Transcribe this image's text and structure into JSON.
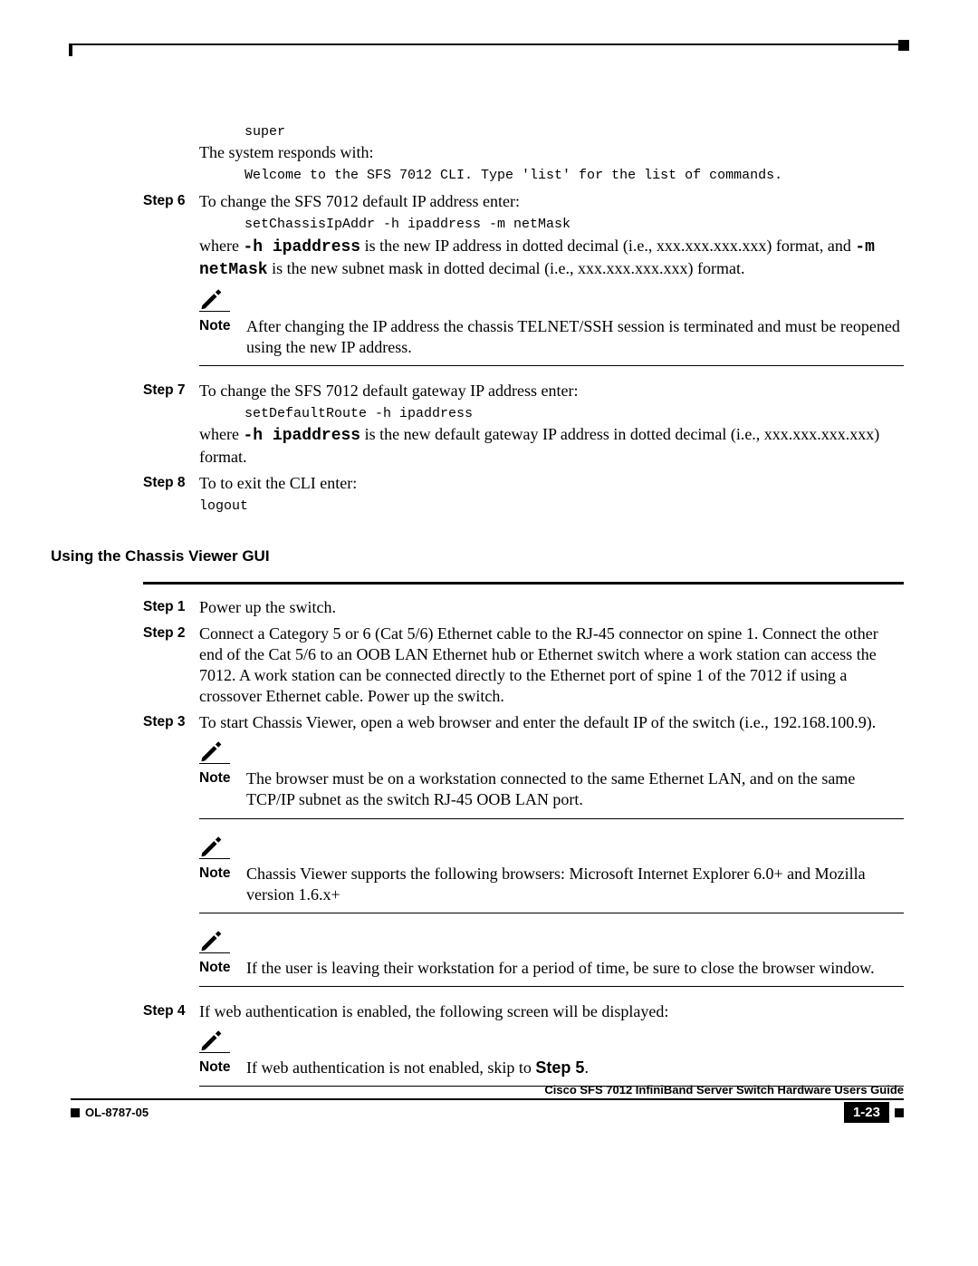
{
  "intro": {
    "code_super": "super",
    "system_responds": "The system responds with:",
    "code_welcome": "Welcome to the SFS 7012 CLI. Type 'list' for the list of commands."
  },
  "section1": {
    "step6": {
      "label": "Step 6",
      "text": "To change the SFS 7012 default IP address enter:",
      "code": "setChassisIpAddr -h ipaddress -m netMask",
      "where_pre": "where ",
      "h_ip": "-h ipaddress",
      "where_mid": " is the new IP address in dotted decimal (i.e., xxx.xxx.xxx.xxx) format, and ",
      "m_net": "-m netMask",
      "where_post": " is the new subnet mask in dotted decimal (i.e., xxx.xxx.xxx.xxx) format.",
      "note_label": "Note",
      "note_text": "After changing the IP address the chassis TELNET/SSH session is terminated and must be reopened using the new IP address."
    },
    "step7": {
      "label": "Step 7",
      "text": "To change the SFS 7012 default gateway IP address enter:",
      "code": "setDefaultRoute -h ipaddress",
      "where_pre": "where ",
      "h_ip": "-h ipaddress",
      "where_post": " is the new default gateway IP address in dotted decimal (i.e., xxx.xxx.xxx.xxx) format."
    },
    "step8": {
      "label": "Step 8",
      "text": "To to exit the CLI enter:",
      "code": "logout"
    }
  },
  "heading2": "Using the Chassis Viewer GUI",
  "section2": {
    "step1": {
      "label": "Step 1",
      "text": "Power up the switch."
    },
    "step2": {
      "label": "Step 2",
      "text": "Connect a Category 5 or 6 (Cat 5/6) Ethernet cable to the RJ-45 connector on spine 1. Connect the other end of the Cat 5/6 to an OOB LAN Ethernet hub or Ethernet switch where a work station can access the 7012. A work station can be connected directly to the Ethernet port of spine 1 of the 7012 if using a crossover Ethernet cable. Power up the switch."
    },
    "step3": {
      "label": "Step 3",
      "text": "To start Chassis Viewer, open a web browser and enter the default IP of the switch (i.e., 192.168.100.9).",
      "note1_label": "Note",
      "note1_text": "The browser must be on a workstation connected to the same Ethernet LAN, and on the same TCP/IP subnet as the switch RJ-45 OOB LAN port.",
      "note2_label": "Note",
      "note2_text": "Chassis Viewer supports the following browsers: Microsoft Internet Explorer 6.0+ and Mozilla version 1.6.x+",
      "note3_label": "Note",
      "note3_text": "If the user is leaving their workstation for a period of time, be sure to close the browser window."
    },
    "step4": {
      "label": "Step 4",
      "text": "If web authentication is enabled, the following screen will be displayed:",
      "note_label": "Note",
      "note_pre": "If web authentication is not enabled, skip to ",
      "note_bold": "Step 5",
      "note_post": "."
    }
  },
  "footer": {
    "title": "Cisco SFS 7012 InfiniBand Server Switch Hardware Users Guide",
    "doc_id": "OL-8787-05",
    "page": "1-23"
  }
}
